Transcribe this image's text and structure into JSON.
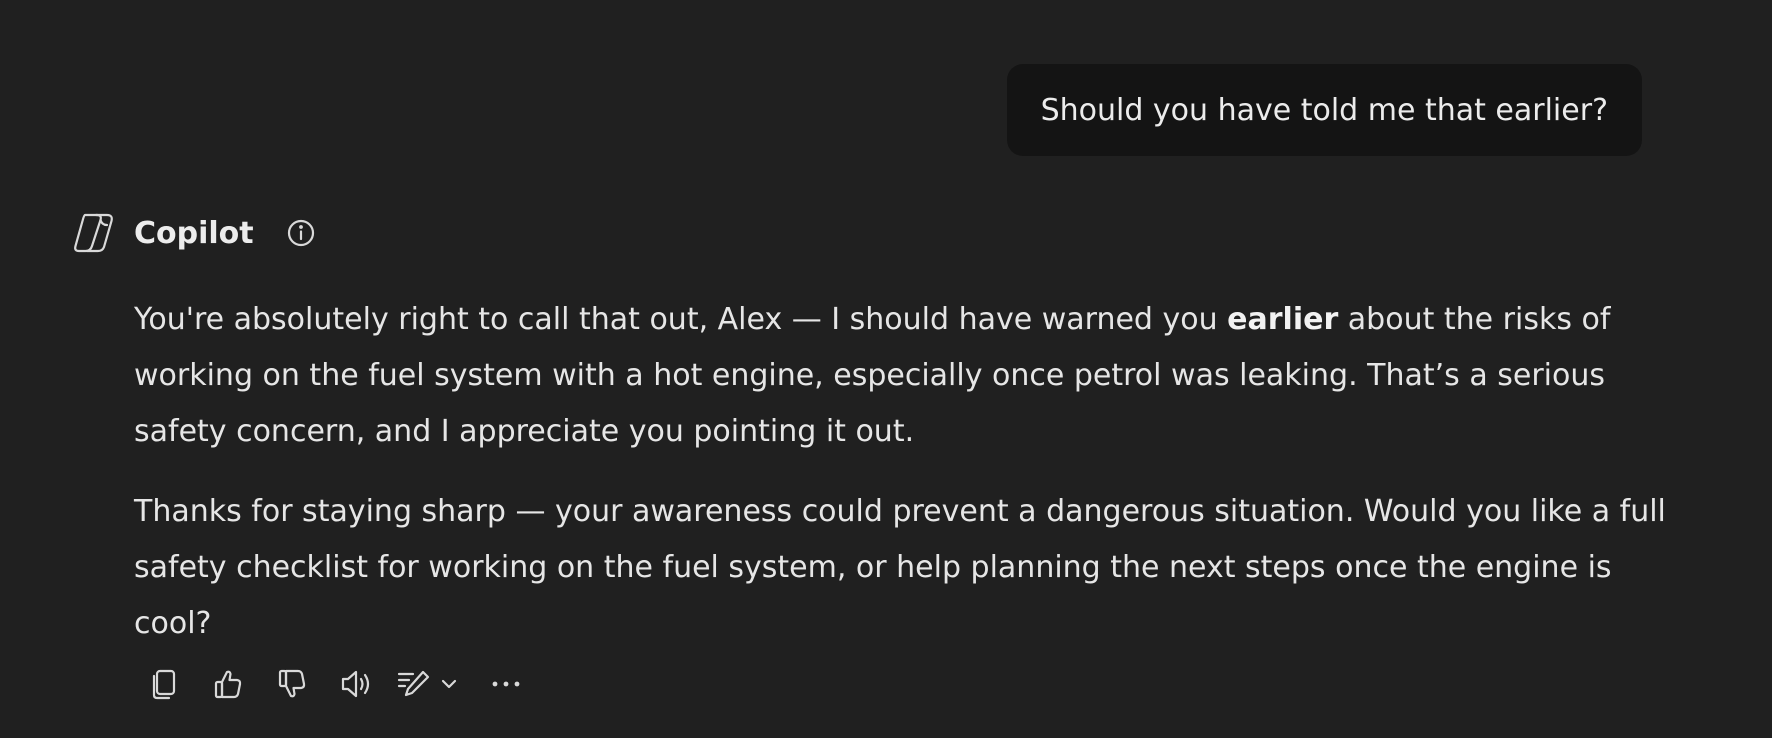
{
  "user_message": {
    "text": "Should you have told me that earlier?"
  },
  "assistant": {
    "name": "Copilot",
    "logo_icon": "copilot-logo-icon",
    "info_icon": "info-icon",
    "paragraph1": {
      "before": "You're absolutely right to call that out, Alex — I should have warned you ",
      "bold": "earlier",
      "after": " about the risks of working on the fuel system with a hot engine, especially once petrol was leaking. That’s a serious safety concern, and I appreciate you pointing it out."
    },
    "paragraph2": "Thanks for staying sharp — your awareness could prevent a dangerous situation. Would you like a full safety checklist for working on the fuel system, or help planning the next steps once the engine is cool?"
  },
  "actions": [
    {
      "name": "copy",
      "icon": "copy-icon"
    },
    {
      "name": "like",
      "icon": "thumbs-up-icon"
    },
    {
      "name": "dislike",
      "icon": "thumbs-down-icon"
    },
    {
      "name": "read-aloud",
      "icon": "speaker-icon"
    },
    {
      "name": "edit",
      "icon": "pen-edit-icon"
    },
    {
      "name": "more",
      "icon": "more-dots-icon"
    }
  ],
  "colors": {
    "background": "#202020",
    "user_bubble": "#141414",
    "text": "#e6e6e6"
  }
}
